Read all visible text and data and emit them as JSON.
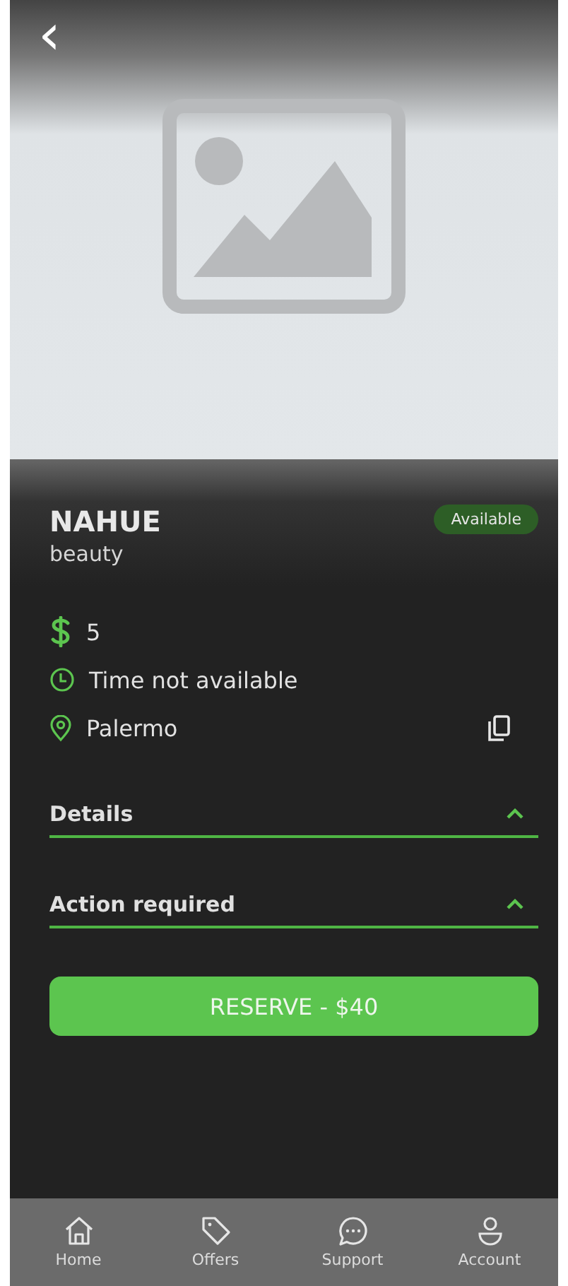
{
  "header": {
    "back": "‹"
  },
  "listing": {
    "name": "NAHUE",
    "category": "beauty",
    "status": "Available"
  },
  "info": [
    {
      "kind": "price",
      "text": "5"
    },
    {
      "kind": "time",
      "text": "Time not available"
    },
    {
      "kind": "location",
      "text": "Palermo",
      "copy": true
    }
  ],
  "sections": [
    {
      "title": "Details",
      "expanded": true
    },
    {
      "title": "Action required",
      "expanded": true
    }
  ],
  "reserve_button": "RESERVE - $40",
  "nav": [
    {
      "kind": "home",
      "label": "Home"
    },
    {
      "kind": "offers",
      "label": "Offers"
    },
    {
      "kind": "support",
      "label": "Support"
    },
    {
      "kind": "account",
      "label": "Account"
    }
  ]
}
